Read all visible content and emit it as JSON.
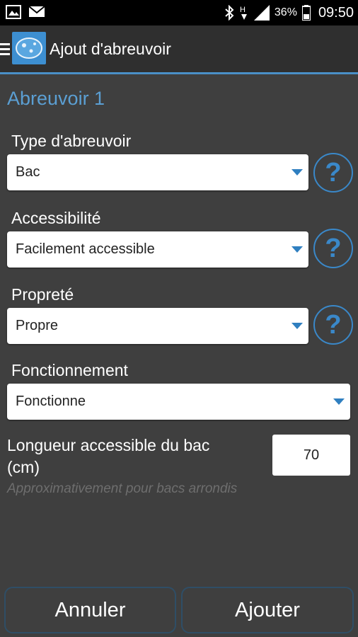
{
  "status_bar": {
    "battery_percent": "36%",
    "time": "09:50",
    "icons": [
      "image-icon",
      "mail-icon",
      "bluetooth-icon",
      "network-h-icon",
      "signal-icon",
      "battery-icon"
    ]
  },
  "header": {
    "title": "Ajout d'abreuvoir"
  },
  "section": {
    "title": "Abreuvoir 1"
  },
  "fields": {
    "type": {
      "label": "Type d'abreuvoir",
      "value": "Bac"
    },
    "accessibility": {
      "label": "Accessibilité",
      "value": "Facilement accessible"
    },
    "cleanliness": {
      "label": "Propreté",
      "value": "Propre"
    },
    "functioning": {
      "label": "Fonctionnement",
      "value": "Fonctionne"
    },
    "length": {
      "label_line1": "Longueur accessible du bac",
      "label_line2": "(cm)",
      "value": "70",
      "hint": "Approximativement pour bacs arrondis"
    }
  },
  "help": {
    "symbol": "?"
  },
  "buttons": {
    "cancel": "Annuler",
    "add": "Ajouter"
  },
  "colors": {
    "accent": "#4a90c8",
    "background": "#3f3f3f",
    "status_bar": "#000000"
  }
}
